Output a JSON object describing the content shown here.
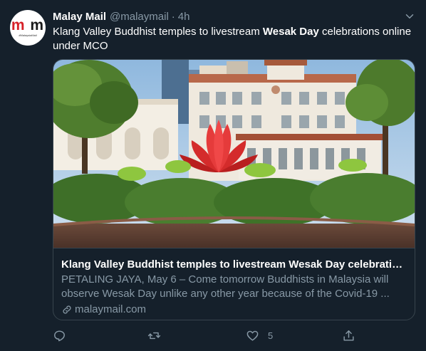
{
  "tweet": {
    "avatar_letters": [
      "m",
      "m"
    ],
    "avatar_tagline": "#MalaysiaMail",
    "display_name": "Malay Mail",
    "handle": "@malaymail",
    "separator": "·",
    "time": "4h",
    "text_before": "Klang Valley Buddhist temples to livestream ",
    "text_bold": "Wesak Day",
    "text_after": " celebrations online under MCO"
  },
  "card": {
    "title": "Klang Valley Buddhist temples to livestream Wesak Day celebrations onl...",
    "description": "PETALING JAYA, May 6 – Come tomorrow Buddhists in Malaysia will observe Wesak Day unlike any other year because of the Covid-19 ...",
    "domain": "malaymail.com"
  },
  "actions": {
    "reply_count": "",
    "retweet_count": "",
    "like_count": "5",
    "share_count": ""
  },
  "colors": {
    "background": "#15202b",
    "text_primary": "#ffffff",
    "text_secondary": "#8899a6",
    "border": "#38444d",
    "brand_red": "#d62028"
  },
  "icons": [
    "chevron-down-icon",
    "link-icon",
    "reply-icon",
    "retweet-icon",
    "like-icon",
    "share-icon"
  ]
}
